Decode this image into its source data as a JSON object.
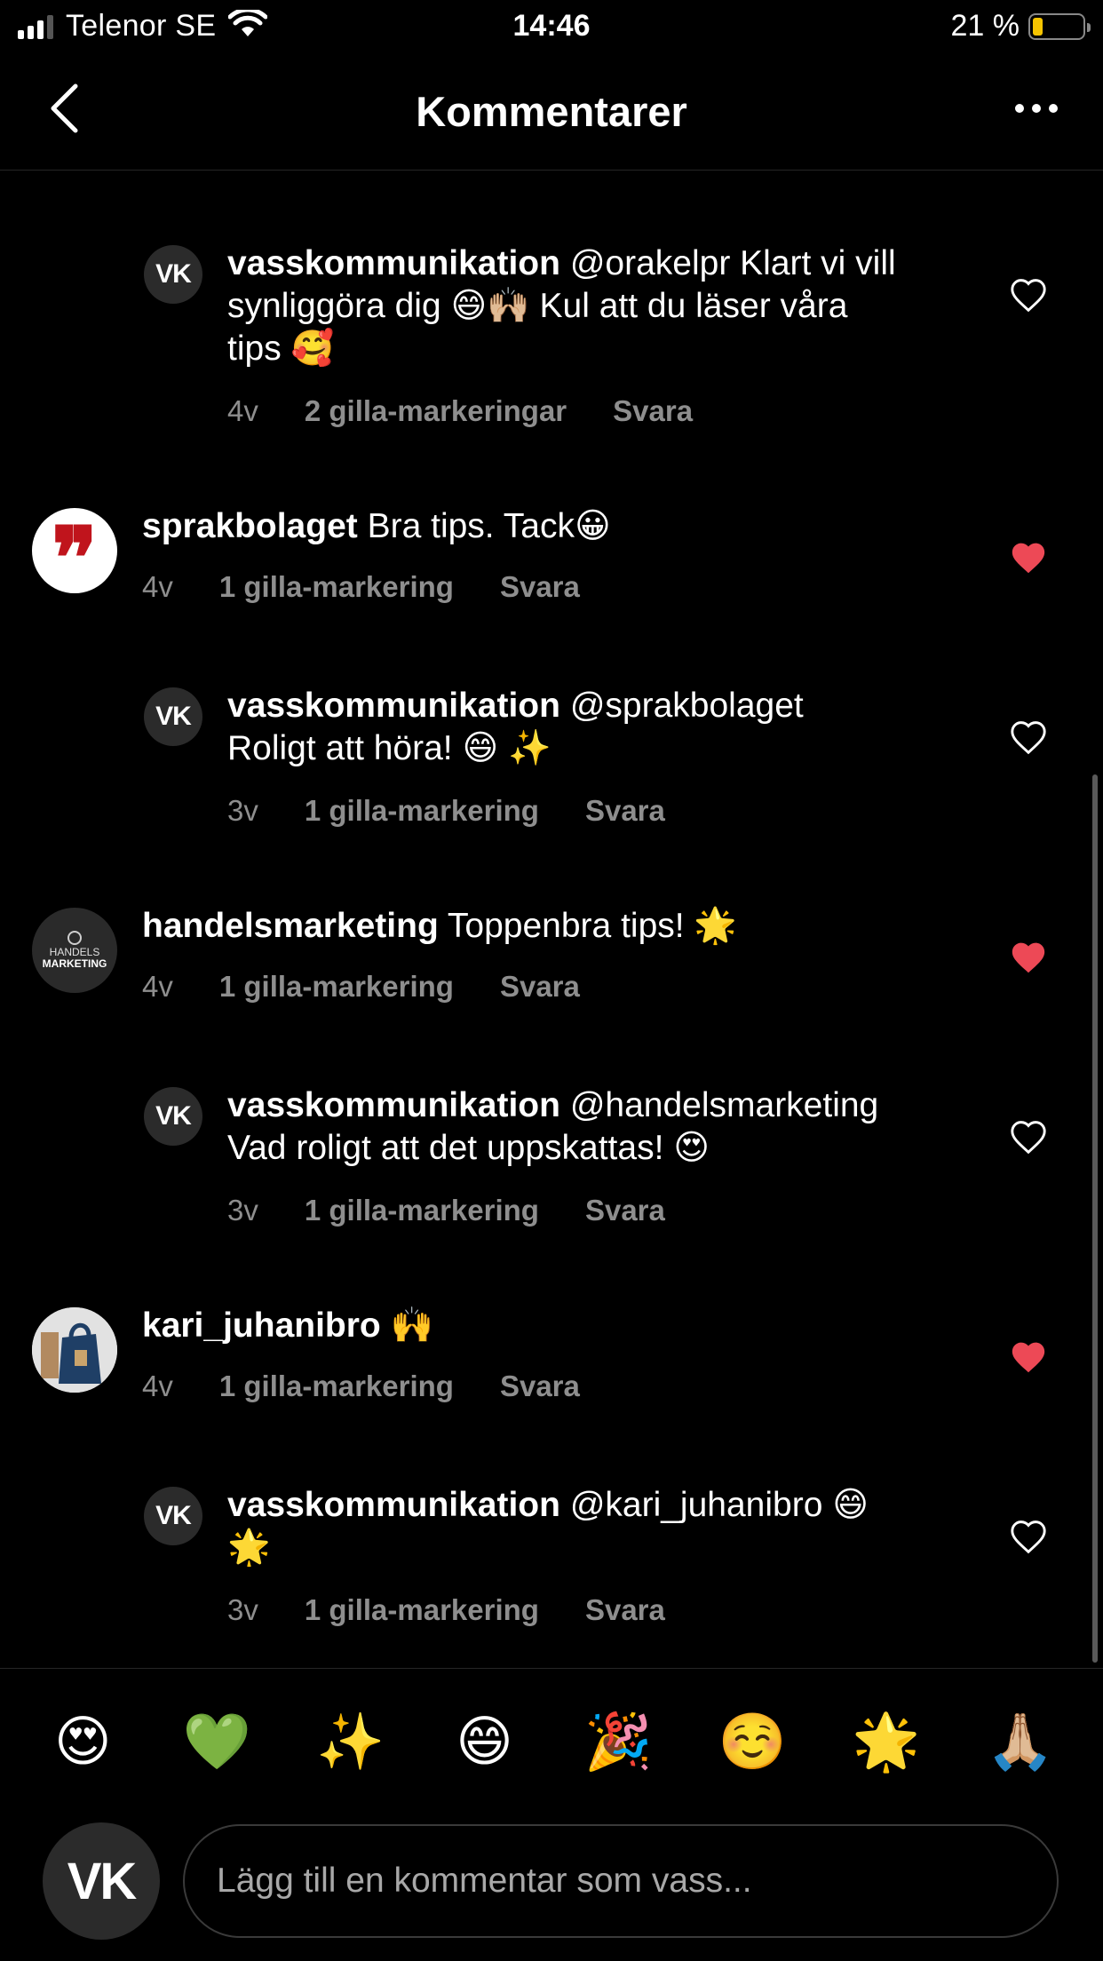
{
  "status_bar": {
    "carrier": "Telenor SE",
    "time": "14:46",
    "battery": "21 %",
    "battery_level": 0.21
  },
  "header": {
    "title": "Kommentarer",
    "back_icon": "chevron-left-icon",
    "more_icon": "more-horizontal-icon"
  },
  "comments": [
    {
      "user": "vasskommunikation",
      "text_line1": "@orakelpr Klart vi vill",
      "text_line2": "synliggöra dig 😄🙌🏼 Kul att du läser våra",
      "text_line3": "tips 🥰",
      "time": "4v",
      "likes": "2 gilla-markeringar",
      "reply": "Svara",
      "liked": false
    },
    {
      "user": "sprakbolaget",
      "text": "Bra tips. Tack😀",
      "time": "4v",
      "likes": "1 gilla-markering",
      "reply": "Svara",
      "liked": true
    },
    {
      "user": "vasskommunikation",
      "text_line1": "@sprakbolaget",
      "text_line2": "Roligt att höra! 😄 ✨",
      "time": "3v",
      "likes": "1 gilla-markering",
      "reply": "Svara",
      "liked": false
    },
    {
      "user": "handelsmarketing",
      "text": "Toppenbra tips! 🌟",
      "time": "4v",
      "likes": "1 gilla-markering",
      "reply": "Svara",
      "liked": true
    },
    {
      "user": "vasskommunikation",
      "text_line1": "@handelsmarketing",
      "text_line2": "Vad roligt att det uppskattas! 😍",
      "time": "3v",
      "likes": "1 gilla-markering",
      "reply": "Svara",
      "liked": false
    },
    {
      "user": "kari_juhanibro",
      "text": "🙌",
      "time": "4v",
      "likes": "1 gilla-markering",
      "reply": "Svara",
      "liked": true
    },
    {
      "user": "vasskommunikation",
      "text_line1": "@kari_juhanibro 😄",
      "text_line2": "🌟",
      "time": "3v",
      "likes": "1 gilla-markering",
      "reply": "Svara",
      "liked": false
    }
  ],
  "avatars": {
    "vk_initials": "VK",
    "sprak_mark": "❞",
    "handels_line1": "HANDELS",
    "handels_line2": "MARKETING"
  },
  "quick_emojis": [
    "😍",
    "💚",
    "✨",
    "😄",
    "🎉",
    "☺️",
    "🌟",
    "🙏🏼"
  ],
  "composer": {
    "placeholder": "Lägg till en kommentar som vass..."
  },
  "colors": {
    "background": "#000000",
    "muted_text": "#8e8e8e",
    "heart_liked": "#ed4956",
    "battery_fill": "#f5c400"
  }
}
